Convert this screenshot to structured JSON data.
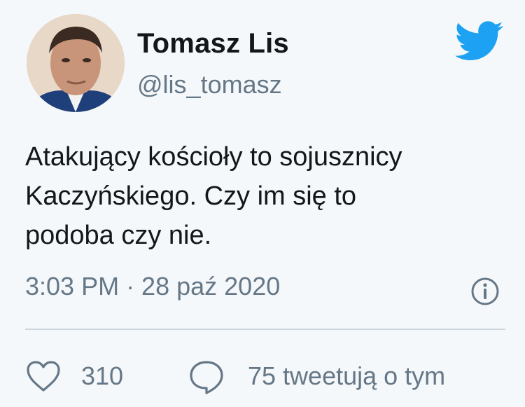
{
  "author": {
    "display_name": "Tomasz Lis",
    "handle": "@lis_tomasz"
  },
  "tweet": {
    "text": "Atakujący kościoły to sojusznicy\nKaczyńskiego. Czy im się  to\npodoba czy nie.",
    "timestamp": "3:03 PM · 28 paź 2020"
  },
  "actions": {
    "like_count": "310",
    "retweet_text": "75 tweetują o tym"
  },
  "icons": {
    "brand": "twitter-bird-icon",
    "info": "info-icon",
    "like": "heart-icon",
    "reply": "speech-bubble-icon"
  },
  "colors": {
    "brand": "#1da1f2",
    "text": "#14171a",
    "secondary": "#657786",
    "divider": "#ccd6dd",
    "background": "#f5f8fa"
  }
}
